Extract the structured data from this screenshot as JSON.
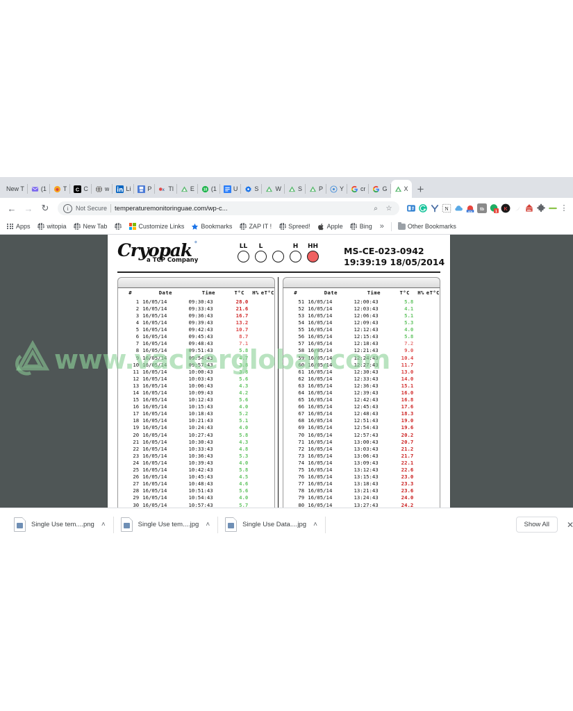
{
  "browser": {
    "tabs": [
      {
        "label": "New T",
        "icon": "none",
        "color": "#ffffff",
        "active": false
      },
      {
        "label": "(1",
        "icon": "mail",
        "color": "#7b68ee",
        "active": false
      },
      {
        "label": "T",
        "icon": "dot",
        "color": "#f5a623",
        "active": false
      },
      {
        "label": "C",
        "icon": "letter-c",
        "color": "#000000",
        "active": false
      },
      {
        "label": "w",
        "icon": "globe",
        "color": "#666666",
        "active": false
      },
      {
        "label": "Li",
        "icon": "linkedin",
        "color": "#0a66c2",
        "active": false
      },
      {
        "label": "P",
        "icon": "save",
        "color": "#4b7bd6",
        "active": false
      },
      {
        "label": "Tl",
        "icon": "ox",
        "color": "#e04848",
        "active": false
      },
      {
        "label": "E",
        "icon": "cryopak",
        "color": "#55b96a",
        "active": false
      },
      {
        "label": "(1",
        "icon": "badge10",
        "color": "#1bb34a",
        "active": false
      },
      {
        "label": "U",
        "icon": "doc",
        "color": "#2d7ff9",
        "active": false
      },
      {
        "label": "S",
        "icon": "gear",
        "color": "#1a73e8",
        "active": false
      },
      {
        "label": "W",
        "icon": "cryopak",
        "color": "#55b96a",
        "active": false
      },
      {
        "label": "S",
        "icon": "cryopak",
        "color": "#55b96a",
        "active": false
      },
      {
        "label": "P",
        "icon": "cryopak",
        "color": "#55b96a",
        "active": false
      },
      {
        "label": "Y",
        "icon": "target",
        "color": "#4a90d9",
        "active": false
      },
      {
        "label": "cr",
        "icon": "google",
        "color": "#4285f4",
        "active": false
      },
      {
        "label": "G",
        "icon": "google",
        "color": "#4285f4",
        "active": false
      },
      {
        "label": "X",
        "icon": "cryopak",
        "color": "#55b96a",
        "active": true
      }
    ],
    "new_tab_label": "+",
    "nav": {
      "back": "←",
      "forward": "→",
      "reload": "↻"
    },
    "omnibox": {
      "security_label": "Not Secure",
      "url": "temperaturemonitoringuae.com/wp-c...",
      "zoom_icon": "⌕",
      "bookmark_icon": "☆"
    },
    "extensions": [
      {
        "name": "reader-extension",
        "color": "#2f7fd0"
      },
      {
        "name": "grammarly-extension",
        "color": "#15c39a"
      },
      {
        "name": "yandex-extension",
        "color": "#ffffff"
      },
      {
        "name": "notion-extension",
        "color": "#ffffff"
      },
      {
        "name": "cloud-extension",
        "color": "#5aa9e6"
      },
      {
        "name": "new-badge-extension",
        "color": "#e8453c"
      },
      {
        "name": "tb-extension",
        "color": "#8a8a8a"
      },
      {
        "name": "counter-extension",
        "color": "#20ac63"
      },
      {
        "name": "k-extension",
        "color": "#1a1a1a"
      },
      {
        "name": "swirl-extension",
        "color": "#e3e3e3"
      },
      {
        "name": "title-extension",
        "color": "#d4443a"
      },
      {
        "name": "puzzle-extension",
        "color": "#5f6368"
      },
      {
        "name": "slider-extension",
        "color": "#8bc34a"
      }
    ],
    "menu_icon": "⋮",
    "bookmarks": [
      {
        "label": "Apps",
        "icon": "apps-grid"
      },
      {
        "label": "witopia",
        "icon": "globe"
      },
      {
        "label": "New Tab",
        "icon": "globe"
      },
      {
        "label": "",
        "icon": "globe"
      },
      {
        "label": "Customize Links",
        "icon": "microsoft"
      },
      {
        "label": "Bookmarks",
        "icon": "star"
      },
      {
        "label": "ZAP IT !",
        "icon": "globe"
      },
      {
        "label": "Spreed!",
        "icon": "globe"
      },
      {
        "label": "Apple",
        "icon": "apple"
      },
      {
        "label": "Bing",
        "icon": "globe"
      }
    ],
    "bookmarks_overflow": "»",
    "other_bookmarks": "Other Bookmarks"
  },
  "report": {
    "logo": {
      "brand": "Cryopak",
      "degree": "°",
      "tagline": "a TCP Company"
    },
    "alarms": [
      {
        "label": "LL",
        "active": false
      },
      {
        "label": "L",
        "active": false
      },
      {
        "label": "",
        "active": false
      },
      {
        "label": "H",
        "active": false
      },
      {
        "label": "HH",
        "active": true
      }
    ],
    "device_id": "MS-CE-023-0942",
    "timestamp": "19:39:19 18/05/2014",
    "alarm_color": "#ef6161",
    "watermark": "www.vackerglobal.com",
    "columns": [
      "#",
      "Date",
      "Time",
      "T°C",
      "H%",
      "eT°C"
    ],
    "left_rows": [
      {
        "n": "1",
        "date": "16/05/14",
        "time": "09:30:43",
        "t": "28.0",
        "c": "#c91c1c"
      },
      {
        "n": "2",
        "date": "16/05/14",
        "time": "09:33:43",
        "t": "21.6",
        "c": "#cd2222"
      },
      {
        "n": "3",
        "date": "16/05/14",
        "time": "09:36:43",
        "t": "16.7",
        "c": "#d02a2a"
      },
      {
        "n": "4",
        "date": "16/05/14",
        "time": "09:39:43",
        "t": "13.2",
        "c": "#d63636"
      },
      {
        "n": "5",
        "date": "16/05/14",
        "time": "09:42:43",
        "t": "10.7",
        "c": "#dc4242"
      },
      {
        "n": "6",
        "date": "16/05/14",
        "time": "09:45:43",
        "t": "8.7",
        "c": "#e05454"
      },
      {
        "n": "7",
        "date": "16/05/14",
        "time": "09:48:43",
        "t": "7.1",
        "c": "#e87878"
      },
      {
        "n": "8",
        "date": "16/05/14",
        "time": "09:51:43",
        "t": "5.8",
        "c": "#63c463"
      },
      {
        "n": "9",
        "date": "16/05/14",
        "time": "09:54:43",
        "t": "4.7",
        "c": "#63c463"
      },
      {
        "n": "10",
        "date": "16/05/14",
        "time": "09:57:43",
        "t": "3.8",
        "c": "#63c463"
      },
      {
        "n": "11",
        "date": "16/05/14",
        "time": "10:00:43",
        "t": "3.8",
        "c": "#63c463"
      },
      {
        "n": "12",
        "date": "16/05/14",
        "time": "10:03:43",
        "t": "5.6",
        "c": "#63c463"
      },
      {
        "n": "13",
        "date": "16/05/14",
        "time": "10:06:43",
        "t": "4.3",
        "c": "#63c463"
      },
      {
        "n": "14",
        "date": "16/05/14",
        "time": "10:09:43",
        "t": "4.2",
        "c": "#63c463"
      },
      {
        "n": "15",
        "date": "16/05/14",
        "time": "10:12:43",
        "t": "5.6",
        "c": "#63c463"
      },
      {
        "n": "16",
        "date": "16/05/14",
        "time": "10:15:43",
        "t": "4.0",
        "c": "#63c463"
      },
      {
        "n": "17",
        "date": "16/05/14",
        "time": "10:18:43",
        "t": "5.2",
        "c": "#63c463"
      },
      {
        "n": "18",
        "date": "16/05/14",
        "time": "10:21:43",
        "t": "5.1",
        "c": "#63c463"
      },
      {
        "n": "19",
        "date": "16/05/14",
        "time": "10:24:43",
        "t": "4.0",
        "c": "#63c463"
      },
      {
        "n": "20",
        "date": "16/05/14",
        "time": "10:27:43",
        "t": "5.8",
        "c": "#63c463"
      },
      {
        "n": "21",
        "date": "16/05/14",
        "time": "10:30:43",
        "t": "4.3",
        "c": "#63c463"
      },
      {
        "n": "22",
        "date": "16/05/14",
        "time": "10:33:43",
        "t": "4.8",
        "c": "#63c463"
      },
      {
        "n": "23",
        "date": "16/05/14",
        "time": "10:36:43",
        "t": "5.3",
        "c": "#63c463"
      },
      {
        "n": "24",
        "date": "16/05/14",
        "time": "10:39:43",
        "t": "4.0",
        "c": "#63c463"
      },
      {
        "n": "25",
        "date": "16/05/14",
        "time": "10:42:43",
        "t": "5.8",
        "c": "#63c463"
      },
      {
        "n": "26",
        "date": "16/05/14",
        "time": "10:45:43",
        "t": "4.5",
        "c": "#63c463"
      },
      {
        "n": "27",
        "date": "16/05/14",
        "time": "10:48:43",
        "t": "4.6",
        "c": "#63c463"
      },
      {
        "n": "28",
        "date": "16/05/14",
        "time": "10:51:43",
        "t": "5.6",
        "c": "#63c463"
      },
      {
        "n": "29",
        "date": "16/05/14",
        "time": "10:54:43",
        "t": "4.0",
        "c": "#63c463"
      },
      {
        "n": "30",
        "date": "16/05/14",
        "time": "10:57:43",
        "t": "5.7",
        "c": "#63c463"
      }
    ],
    "right_rows": [
      {
        "n": "51",
        "date": "16/05/14",
        "time": "12:00:43",
        "t": "5.8",
        "c": "#63c463"
      },
      {
        "n": "52",
        "date": "16/05/14",
        "time": "12:03:43",
        "t": "4.1",
        "c": "#63c463"
      },
      {
        "n": "53",
        "date": "16/05/14",
        "time": "12:06:43",
        "t": "5.1",
        "c": "#63c463"
      },
      {
        "n": "54",
        "date": "16/05/14",
        "time": "12:09:43",
        "t": "5.3",
        "c": "#63c463"
      },
      {
        "n": "55",
        "date": "16/05/14",
        "time": "12:12:43",
        "t": "4.0",
        "c": "#63c463"
      },
      {
        "n": "56",
        "date": "16/05/14",
        "time": "12:15:43",
        "t": "5.8",
        "c": "#63c463"
      },
      {
        "n": "57",
        "date": "16/05/14",
        "time": "12:18:43",
        "t": "7.2",
        "c": "#e87878"
      },
      {
        "n": "58",
        "date": "16/05/14",
        "time": "12:21:43",
        "t": "9.0",
        "c": "#e05454"
      },
      {
        "n": "59",
        "date": "16/05/14",
        "time": "12:24:43",
        "t": "10.4",
        "c": "#dc4242"
      },
      {
        "n": "60",
        "date": "16/05/14",
        "time": "12:27:43",
        "t": "11.7",
        "c": "#d83c3c"
      },
      {
        "n": "61",
        "date": "16/05/14",
        "time": "12:30:43",
        "t": "13.0",
        "c": "#d63636"
      },
      {
        "n": "62",
        "date": "16/05/14",
        "time": "12:33:43",
        "t": "14.0",
        "c": "#d43232"
      },
      {
        "n": "63",
        "date": "16/05/14",
        "time": "12:36:43",
        "t": "15.1",
        "c": "#d22e2e"
      },
      {
        "n": "64",
        "date": "16/05/14",
        "time": "12:39:43",
        "t": "16.0",
        "c": "#d02a2a"
      },
      {
        "n": "65",
        "date": "16/05/14",
        "time": "12:42:43",
        "t": "16.8",
        "c": "#d02a2a"
      },
      {
        "n": "66",
        "date": "16/05/14",
        "time": "12:45:43",
        "t": "17.6",
        "c": "#ce2727"
      },
      {
        "n": "67",
        "date": "16/05/14",
        "time": "12:48:43",
        "t": "18.3",
        "c": "#cd2525"
      },
      {
        "n": "68",
        "date": "16/05/14",
        "time": "12:51:43",
        "t": "19.0",
        "c": "#cd2323"
      },
      {
        "n": "69",
        "date": "16/05/14",
        "time": "12:54:43",
        "t": "19.6",
        "c": "#cc2222"
      },
      {
        "n": "70",
        "date": "16/05/14",
        "time": "12:57:43",
        "t": "20.2",
        "c": "#cc2121"
      },
      {
        "n": "71",
        "date": "16/05/14",
        "time": "13:00:43",
        "t": "20.7",
        "c": "#cb2020"
      },
      {
        "n": "72",
        "date": "16/05/14",
        "time": "13:03:43",
        "t": "21.2",
        "c": "#cb1f1f"
      },
      {
        "n": "73",
        "date": "16/05/14",
        "time": "13:06:43",
        "t": "21.7",
        "c": "#ca1e1e"
      },
      {
        "n": "74",
        "date": "16/05/14",
        "time": "13:09:43",
        "t": "22.1",
        "c": "#ca1e1e"
      },
      {
        "n": "75",
        "date": "16/05/14",
        "time": "13:12:43",
        "t": "22.6",
        "c": "#c91d1d"
      },
      {
        "n": "76",
        "date": "16/05/14",
        "time": "13:15:43",
        "t": "23.0",
        "c": "#c91c1c"
      },
      {
        "n": "77",
        "date": "16/05/14",
        "time": "13:18:43",
        "t": "23.3",
        "c": "#c91c1c"
      },
      {
        "n": "78",
        "date": "16/05/14",
        "time": "13:21:43",
        "t": "23.6",
        "c": "#c81b1b"
      },
      {
        "n": "79",
        "date": "16/05/14",
        "time": "13:24:43",
        "t": "24.0",
        "c": "#c81b1b"
      },
      {
        "n": "80",
        "date": "16/05/14",
        "time": "13:27:43",
        "t": "24.2",
        "c": "#c81a1a"
      }
    ]
  },
  "downloads": {
    "items": [
      {
        "name": "Single Use tem....png"
      },
      {
        "name": "Single Use tem....jpg"
      },
      {
        "name": "Single Use Data....jpg"
      }
    ],
    "caret": "˄",
    "show_all_label": "Show All",
    "close_label": "✕"
  }
}
